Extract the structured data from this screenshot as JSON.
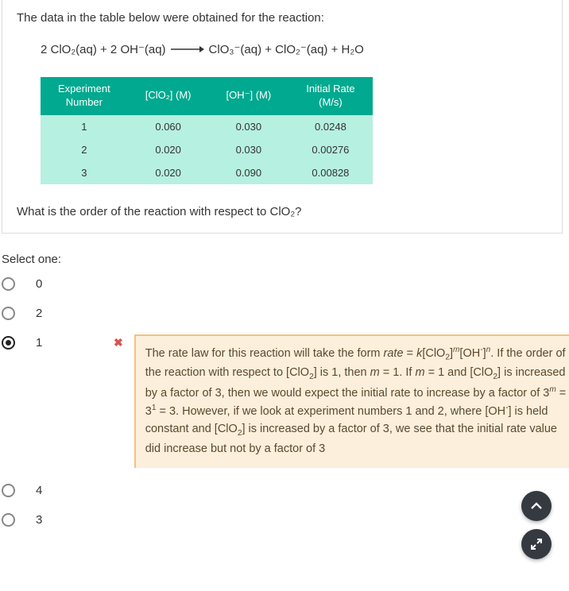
{
  "intro": "The data in the table below were obtained for the reaction:",
  "equation": {
    "left": "2 ClO₂(aq)  +  2 OH⁻(aq)",
    "right": "ClO₃⁻(aq)  +  ClO₂⁻(aq)  +  H₂O"
  },
  "table": {
    "headers": [
      "Experiment Number",
      "[ClO₂] (M)",
      "[OH⁻] (M)",
      "Initial Rate (M/s)"
    ],
    "rows": [
      [
        "1",
        "0.060",
        "0.030",
        "0.0248"
      ],
      [
        "2",
        "0.020",
        "0.030",
        "0.00276"
      ],
      [
        "3",
        "0.020",
        "0.090",
        "0.00828"
      ]
    ]
  },
  "question": "What is the order of the reaction with respect to ClO₂?",
  "select_label": "Select one:",
  "options": [
    {
      "label": "0",
      "selected": false
    },
    {
      "label": "2",
      "selected": false
    },
    {
      "label": "1",
      "selected": true
    },
    {
      "label": "4",
      "selected": false
    },
    {
      "label": "3",
      "selected": false
    }
  ],
  "feedback": "The rate law for this reaction will take the form rate = k[ClO₂]ᵐ[OH⁻]ⁿ. If the order of the reaction with respect to [ClO₂] is 1, then m = 1. If m = 1 and [ClO₂] is increased by a factor of 3, then we would expect the initial rate to increase by a factor of 3ᵐ = 3¹ = 3. However, if we look at experiment numbers 1 and 2, where [OH⁻] is held constant and [ClO₂] is increased by a factor of 3, we see that the initial rate value did increase but not by a factor of 3",
  "chart_data": {
    "type": "table",
    "title": "Reaction rate data",
    "columns": [
      "Experiment Number",
      "[ClO2] (M)",
      "[OH-] (M)",
      "Initial Rate (M/s)"
    ],
    "rows": [
      [
        1,
        0.06,
        0.03,
        0.0248
      ],
      [
        2,
        0.02,
        0.03,
        0.00276
      ],
      [
        3,
        0.02,
        0.09,
        0.00828
      ]
    ]
  }
}
